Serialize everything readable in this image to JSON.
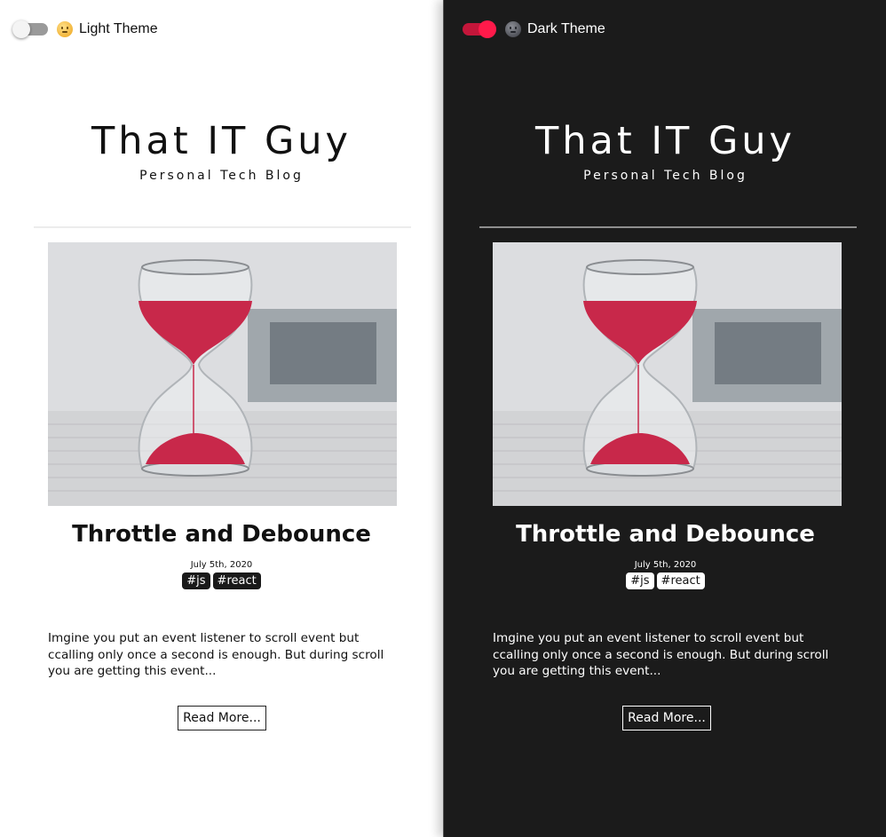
{
  "light": {
    "theme_label": "Light Theme",
    "toggle_on": false,
    "theme_icon": "smiling-sun-emoji-icon",
    "site_title": "That IT Guy",
    "site_subtitle": "Personal Tech Blog",
    "post": {
      "image_alt": "hourglass-with-red-sand-image",
      "title": "Throttle and Debounce",
      "date": "July 5th, 2020",
      "tags": [
        "#js",
        "#react"
      ],
      "excerpt": "Imgine you put an event listener to scroll event but ccalling only once a second is enough. But during scroll you are getting this event...",
      "read_more_label": "Read More..."
    }
  },
  "dark": {
    "theme_label": "Dark Theme",
    "toggle_on": true,
    "theme_icon": "moon-emoji-icon",
    "site_title": "That IT Guy",
    "site_subtitle": "Personal Tech Blog",
    "post": {
      "image_alt": "hourglass-with-red-sand-image",
      "title": "Throttle and Debounce",
      "date": "July 5th, 2020",
      "tags": [
        "#js",
        "#react"
      ],
      "excerpt": "Imgine you put an event listener to scroll event but ccalling only once a second is enough. But during scroll you are getting this event...",
      "read_more_label": "Read More..."
    }
  },
  "colors": {
    "light_bg": "#ffffff",
    "dark_bg": "#1b1b1b",
    "toggle_off_track": "#9a9a9a",
    "toggle_on_track": "#c4163a",
    "toggle_on_knob": "#ff1a4a",
    "sand_red": "#c8284a"
  }
}
